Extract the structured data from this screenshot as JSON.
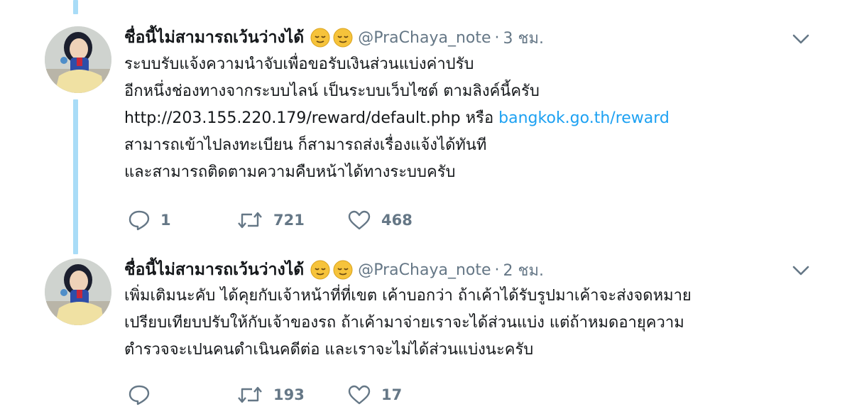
{
  "tweets": [
    {
      "display_name": "ชื่อนี้ไม่สามารถเว้นว่างได้",
      "handle": "@PraChaya_note",
      "separator": "·",
      "time": "3 ชม.",
      "body": {
        "line1": "ระบบรับแจ้งความนำจับเพื่อขอรับเงินส่วนแบ่งค่าปรับ",
        "line2": "อีกหนึ่งช่องทางจากระบบไลน์ เป็นระบบเว็บไซต์ ตามลิงค์นี้ครับ",
        "line3_url": "http://203.155.220.179/reward/default.php",
        "line3_or": "หรือ",
        "line3_link": "bangkok.go.th/reward",
        "line4": "สามารถเข้าไปลงทะเบียน ก็สามารถส่งเรื่องแจ้งได้ทันที",
        "line5": "และสามารถติดตามความคืบหน้าได้ทางระบบครับ"
      },
      "replies": "1",
      "retweets": "721",
      "likes": "468"
    },
    {
      "display_name": "ชื่อนี้ไม่สามารถเว้นว่างได้",
      "handle": "@PraChaya_note",
      "separator": "·",
      "time": "2 ชม.",
      "body": {
        "line1": "เพิ่มเติมนะคับ ได้คุยกับเจ้าหน้าที่ที่เขต เค้าบอกว่า ถ้าเค้าได้รับรูปมาเค้าจะส่งจดหมาย",
        "line2": "เปรียบเทียบปรับให้กับเจ้าของรถ ถ้าเค้ามาจ่ายเราจะได้ส่วนแบ่ง แต่ถ้าหมดอายุความ",
        "line3": "ตำรวจจะเปนคนดำเนินคดีต่อ และเราจะไม่ได้ส่วนแบ่งนะครับ"
      },
      "replies": "",
      "retweets": "193",
      "likes": "17"
    }
  ],
  "icons": {
    "reply": "reply-icon",
    "retweet": "retweet-icon",
    "like": "heart-icon",
    "caret": "chevron-down-icon",
    "emoji": "relieved-face-emoji-icon"
  },
  "colors": {
    "thread_line": "#a9dcf7",
    "link": "#1da1f2",
    "muted": "#657786",
    "text": "#14171a"
  }
}
